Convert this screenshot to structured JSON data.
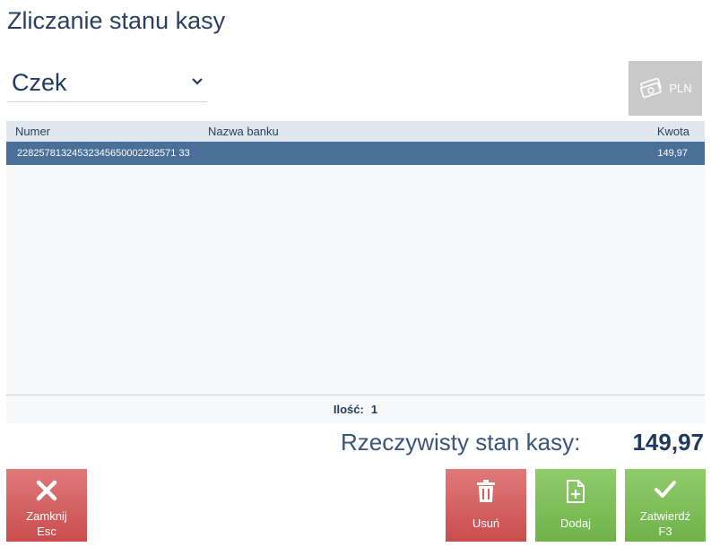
{
  "title": "Zliczanie stanu kasy",
  "payment_type": {
    "selected": "Czek"
  },
  "currency_button": {
    "label": "PLN"
  },
  "grid": {
    "columns": {
      "number": "Numer",
      "bank": "Nazwa banku",
      "amount": "Kwota"
    },
    "rows": [
      {
        "number": "22825781324532345650002282571 33",
        "bank": "",
        "amount": "149,97"
      }
    ],
    "footer": {
      "count_label": "Ilość:",
      "count_value": "1"
    }
  },
  "total": {
    "label": "Rzeczywisty stan kasy:",
    "value": "149,97"
  },
  "buttons": {
    "close": {
      "line1": "Zamknij",
      "line2": "Esc"
    },
    "delete": {
      "label": "Usuń"
    },
    "add": {
      "label": "Dodaj"
    },
    "confirm": {
      "line1": "Zatwierdź",
      "line2": "F3"
    }
  },
  "colors": {
    "selected_row": "#4a6f99",
    "header_bg": "#dfe6ee",
    "danger": "#d15b5b",
    "success": "#7dbf58",
    "disabled": "#c9c9c9"
  }
}
